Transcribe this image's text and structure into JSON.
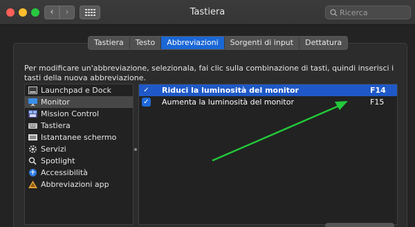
{
  "window": {
    "title": "Tastiera",
    "search_placeholder": "Ricerca"
  },
  "tabs": [
    {
      "label": "Tastiera",
      "active": false
    },
    {
      "label": "Testo",
      "active": false
    },
    {
      "label": "Abbreviazioni",
      "active": true
    },
    {
      "label": "Sorgenti di input",
      "active": false
    },
    {
      "label": "Dettatura",
      "active": false
    }
  ],
  "info_text": "Per modificare un'abbreviazione, selezionala, fai clic sulla combinazione di tasti, quindi inserisci i tasti della nuova abbreviazione.",
  "sidebar": {
    "items": [
      {
        "label": "Launchpad e Dock",
        "icon": "launchpad-dock-icon"
      },
      {
        "label": "Monitor",
        "icon": "display-icon",
        "selected": true
      },
      {
        "label": "Mission Control",
        "icon": "mission-control-icon"
      },
      {
        "label": "Tastiera",
        "icon": "keyboard-icon"
      },
      {
        "label": "Istantanee schermo",
        "icon": "screenshot-icon"
      },
      {
        "label": "Servizi",
        "icon": "gear-icon"
      },
      {
        "label": "Spotlight",
        "icon": "search-icon"
      },
      {
        "label": "Accessibilità",
        "icon": "accessibility-icon"
      },
      {
        "label": "Abbreviazioni app",
        "icon": "app-shortcuts-icon"
      }
    ]
  },
  "shortcuts": [
    {
      "checked": true,
      "name": "Riduci la luminosità del monitor",
      "key": "F14",
      "selected": true
    },
    {
      "checked": true,
      "name": "Aumenta la luminosità del monitor",
      "key": "F15",
      "selected": false
    }
  ],
  "colors": {
    "accent": "#1f59c7",
    "annotation_arrow": "#22c93a"
  }
}
